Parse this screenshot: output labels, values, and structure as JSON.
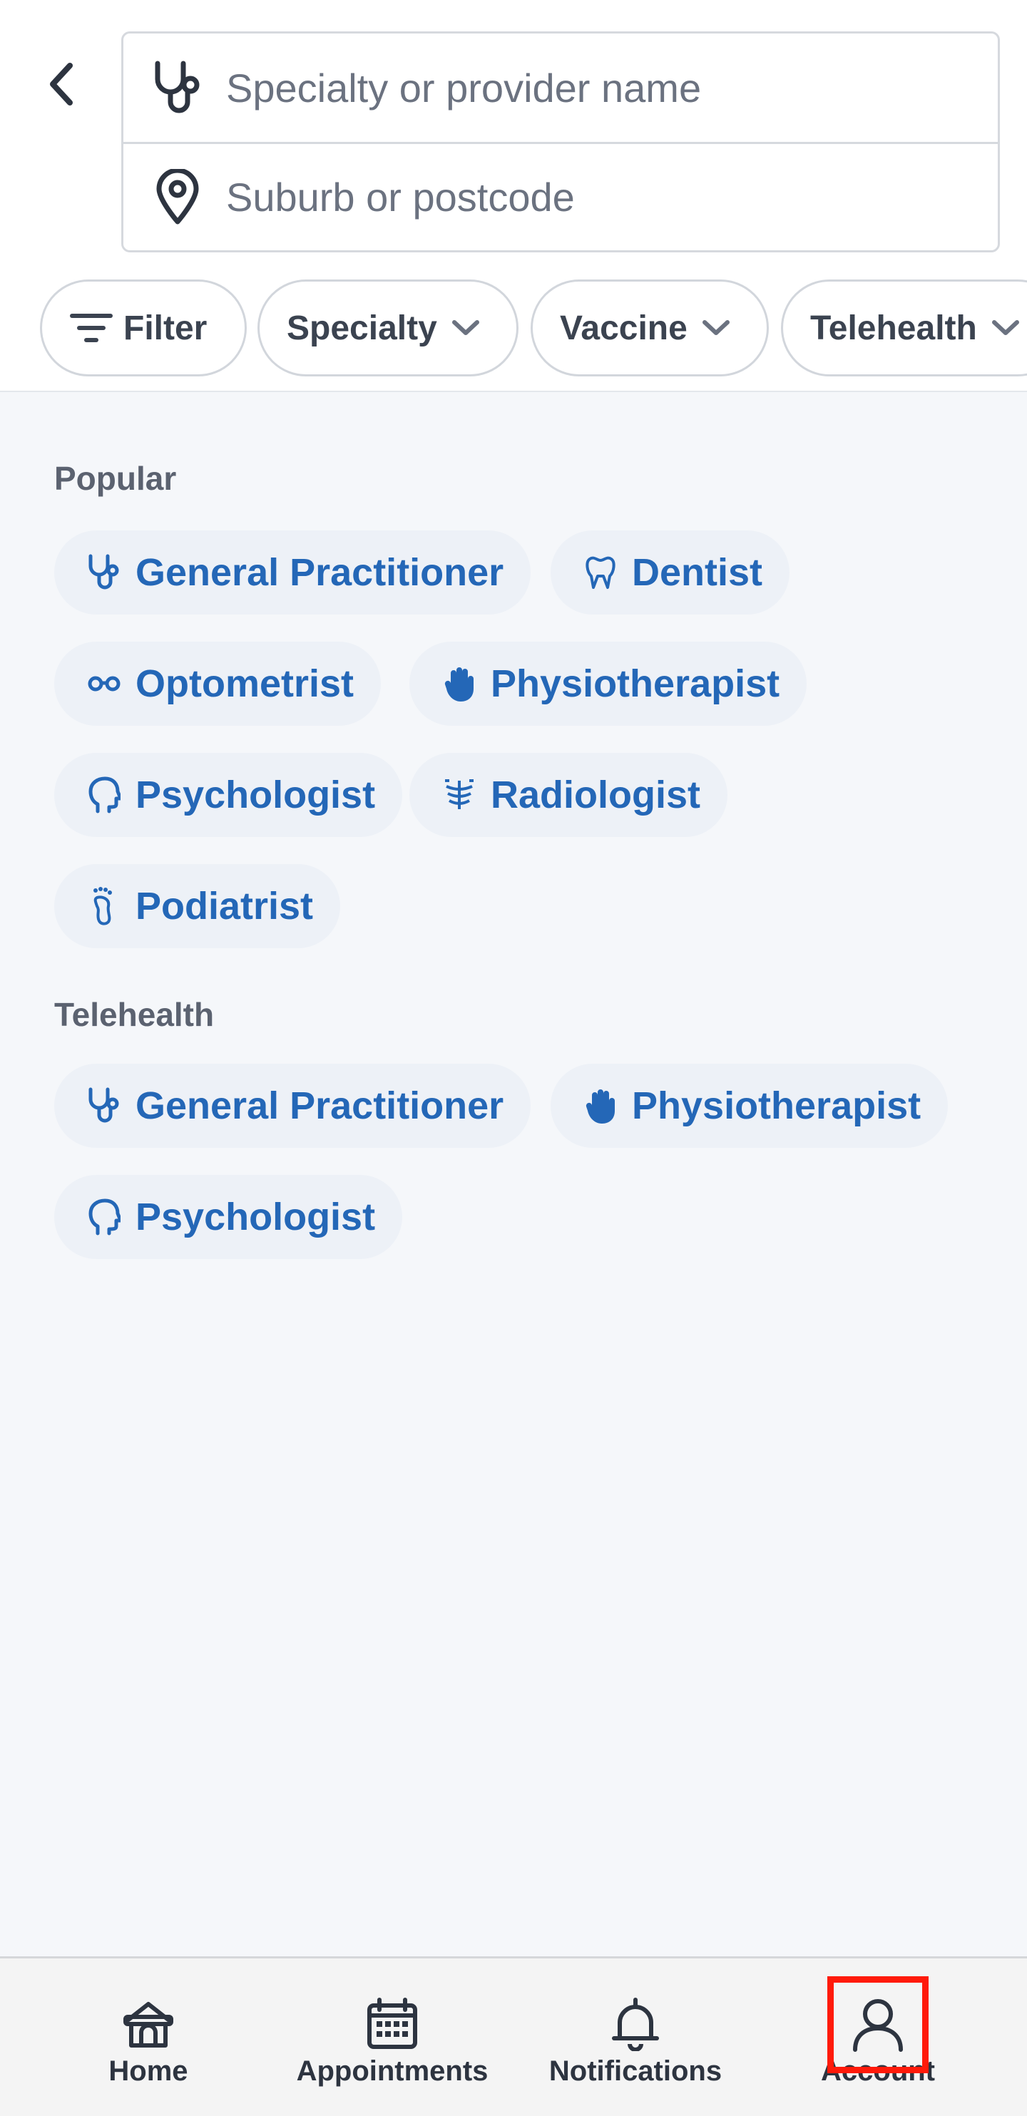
{
  "search": {
    "specialty_placeholder": "Specialty or provider name",
    "location_placeholder": "Suburb or postcode"
  },
  "filters": {
    "filter_label": "Filter",
    "specialty_label": "Specialty",
    "vaccine_label": "Vaccine",
    "telehealth_label": "Telehealth"
  },
  "sections": {
    "popular": {
      "title": "Popular",
      "items": [
        {
          "label": "General Practitioner",
          "icon": "stethoscope-icon"
        },
        {
          "label": "Dentist",
          "icon": "tooth-icon"
        },
        {
          "label": "Optometrist",
          "icon": "glasses-icon"
        },
        {
          "label": "Physiotherapist",
          "icon": "hand-icon"
        },
        {
          "label": "Psychologist",
          "icon": "head-icon"
        },
        {
          "label": "Radiologist",
          "icon": "xray-icon"
        },
        {
          "label": "Podiatrist",
          "icon": "foot-icon"
        }
      ]
    },
    "telehealth": {
      "title": "Telehealth",
      "items": [
        {
          "label": "General Practitioner",
          "icon": "stethoscope-icon"
        },
        {
          "label": "Physiotherapist",
          "icon": "hand-icon"
        },
        {
          "label": "Psychologist",
          "icon": "head-icon"
        }
      ]
    }
  },
  "bottom_nav": {
    "home": "Home",
    "appointments": "Appointments",
    "notifications": "Notifications",
    "account": "Account"
  },
  "colors": {
    "accent": "#2467b7",
    "highlight": "#ff1a0a",
    "tag_bg": "#edf1f7"
  }
}
